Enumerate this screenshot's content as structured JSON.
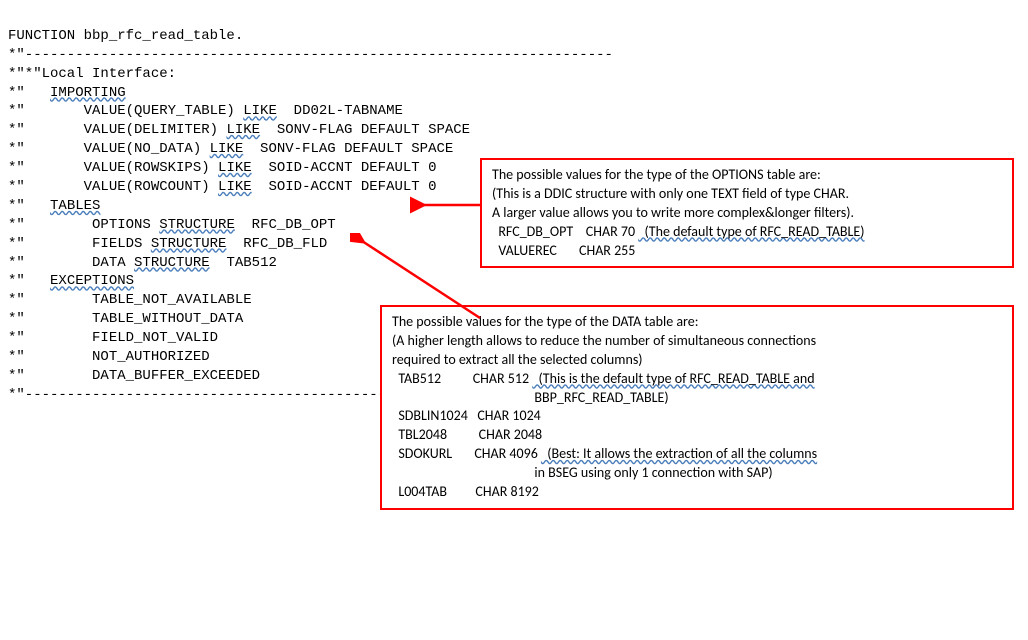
{
  "code": {
    "l0": "FUNCTION bbp_rfc_read_table.",
    "dash": "*\"----------------------------------------------------------------------",
    "l2": "*\"*\"Local Interface:",
    "kw_importing": "IMPORTING",
    "l4a": "*\"       VALUE(QUERY_TABLE) ",
    "kw_like": "LIKE",
    "l4c": "  DD02L-TABNAME",
    "l5a": "*\"       VALUE(DELIMITER) ",
    "l5c": "  SONV-FLAG DEFAULT SPACE",
    "l6a": "*\"       VALUE(NO_DATA) ",
    "l6c": "  SONV-FLAG DEFAULT SPACE",
    "l7a": "*\"       VALUE(ROWSKIPS) ",
    "l7c": "  SOID-ACCNT DEFAULT 0",
    "l8a": "*\"       VALUE(ROWCOUNT) ",
    "l8c": "  SOID-ACCNT DEFAULT 0",
    "kw_tables": "TABLES",
    "l10a": "*\"        OPTIONS ",
    "kw_structure": "STRUCTURE",
    "l10c": "  RFC_DB_OPT",
    "l11a": "*\"        FIELDS ",
    "l11c": "  RFC_DB_FLD",
    "l12a": "*\"        DATA ",
    "l12c": "  TAB512",
    "kw_exceptions": "EXCEPTIONS",
    "l14": "*\"        TABLE_NOT_AVAILABLE",
    "l15": "*\"        TABLE_WITHOUT_DATA",
    "l16": "*\"        FIELD_NOT_VALID",
    "l17": "*\"        NOT_AUTHORIZED",
    "l18": "*\"        DATA_BUFFER_EXCEEDED",
    "star": "*\"   "
  },
  "callout1": {
    "title": "The possible values for the type of the OPTIONS table are:",
    "sub1": "(This is a DDIC structure with only one TEXT field of type CHAR.",
    "sub2": " A larger value allows you to write more complex&longer filters).",
    "row1a": "  RFC_DB_OPT    CHAR 70 ",
    "row1b": "  (The default type of RFC_READ_TABLE)",
    "row2": "  VALUEREC       CHAR 255"
  },
  "callout2": {
    "title": "The possible values for the type of the DATA table are:",
    "sub1": "(A higher length allows to reduce the number of simultaneous connections",
    "sub2": " required to extract all the selected columns)",
    "row1a": "  TAB512          CHAR 512 ",
    "row1b": "  (This is the default type of RFC_READ_TABLE and",
    "row1c": "                                             BBP_RFC_READ_TABLE)",
    "row2": "  SDBLIN1024   CHAR 1024",
    "row3": "  TBL2048          CHAR 2048",
    "row4a": "  SDOKURL       CHAR 4096 ",
    "row4b": "  (Best: It allows the extraction of all the columns",
    "row4c": "                                             in BSEG using only 1 connection with SAP)",
    "row5": "  L004TAB         CHAR 8192"
  }
}
